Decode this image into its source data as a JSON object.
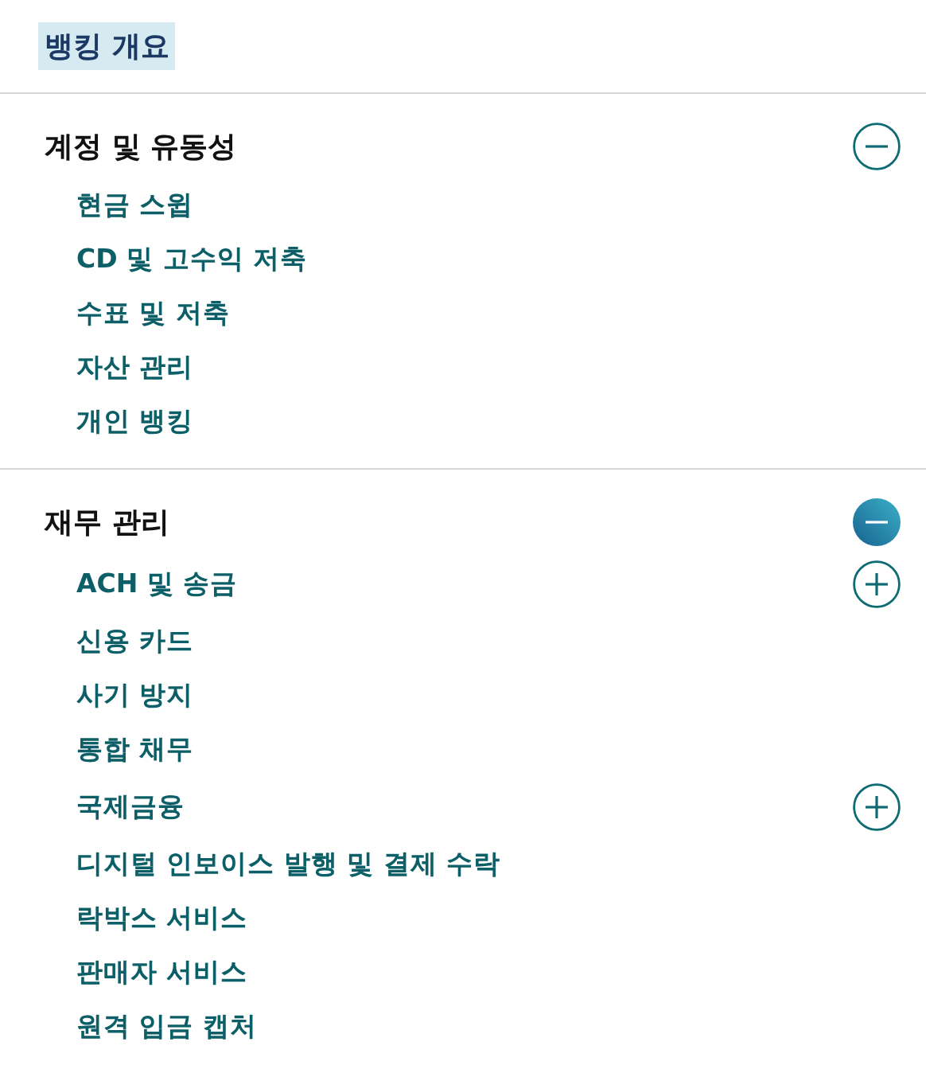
{
  "overview": {
    "label": "뱅킹 개요",
    "selected": true
  },
  "sections": [
    {
      "title": "계정 및 유동성",
      "expanded": true,
      "focused": false,
      "items": [
        {
          "kind": "link",
          "label": "현금 스윕"
        },
        {
          "kind": "link",
          "label": "CD 및 고수익 저축"
        },
        {
          "kind": "link",
          "label": "수표 및 저축"
        },
        {
          "kind": "link",
          "label": "자산 관리"
        },
        {
          "kind": "link",
          "label": "개인 뱅킹"
        }
      ]
    },
    {
      "title": "재무 관리",
      "expanded": true,
      "focused": true,
      "items": [
        {
          "kind": "group",
          "label": "ACH 및 송금",
          "expanded": false
        },
        {
          "kind": "link",
          "label": "신용 카드"
        },
        {
          "kind": "link",
          "label": "사기 방지"
        },
        {
          "kind": "link",
          "label": "통합 채무"
        },
        {
          "kind": "group",
          "label": "국제금융",
          "expanded": false
        },
        {
          "kind": "link",
          "label": "디지털 인보이스 발행 및 결제 수락"
        },
        {
          "kind": "link",
          "label": "락박스 서비스"
        },
        {
          "kind": "link",
          "label": "판매자 서비스"
        },
        {
          "kind": "link",
          "label": "원격 입금 캡처"
        }
      ]
    }
  ]
}
